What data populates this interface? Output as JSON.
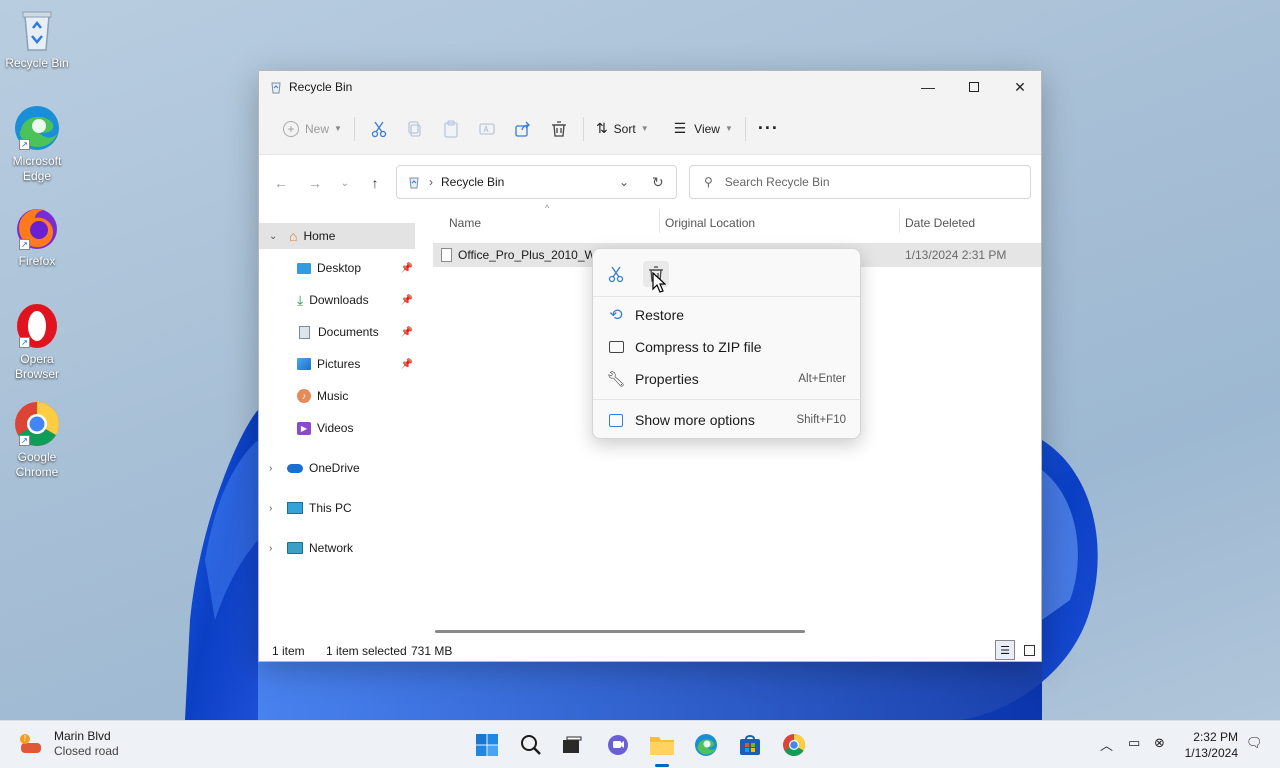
{
  "desktop": {
    "icons": [
      {
        "label": "Recycle Bin"
      },
      {
        "label": "Microsoft Edge"
      },
      {
        "label": "Firefox"
      },
      {
        "label": "Opera Browser"
      },
      {
        "label": "Google Chrome"
      }
    ]
  },
  "window": {
    "title": "Recycle Bin",
    "toolbar": {
      "new_label": "New",
      "sort_label": "Sort",
      "view_label": "View",
      "more_label": "···"
    },
    "address": {
      "breadcrumb": "Recycle Bin",
      "search_placeholder": "Search Recycle Bin"
    },
    "sidebar": {
      "home": "Home",
      "items": [
        {
          "label": "Desktop"
        },
        {
          "label": "Downloads"
        },
        {
          "label": "Documents"
        },
        {
          "label": "Pictures"
        },
        {
          "label": "Music"
        },
        {
          "label": "Videos"
        }
      ],
      "onedrive": "OneDrive",
      "thispc": "This PC",
      "network": "Network"
    },
    "columns": {
      "name": "Name",
      "original_location": "Original Location",
      "date_deleted": "Date Deleted"
    },
    "files": [
      {
        "name": "Office_Pro_Plus_2010_W32",
        "date_deleted": "1/13/2024 2:31 PM"
      }
    ],
    "status": {
      "count": "1 item",
      "selected": "1 item selected",
      "size": "731 MB"
    }
  },
  "context_menu": {
    "items": [
      {
        "label": "Restore",
        "shortcut": ""
      },
      {
        "label": "Compress to ZIP file",
        "shortcut": ""
      },
      {
        "label": "Properties",
        "shortcut": "Alt+Enter"
      },
      {
        "label": "Show more options",
        "shortcut": "Shift+F10"
      }
    ]
  },
  "taskbar": {
    "widget_title": "Marin Blvd",
    "widget_sub": "Closed road",
    "time": "2:32 PM",
    "date": "1/13/2024"
  },
  "colors": {
    "accent": "#0067c0",
    "selection": "#e5e5e5"
  }
}
